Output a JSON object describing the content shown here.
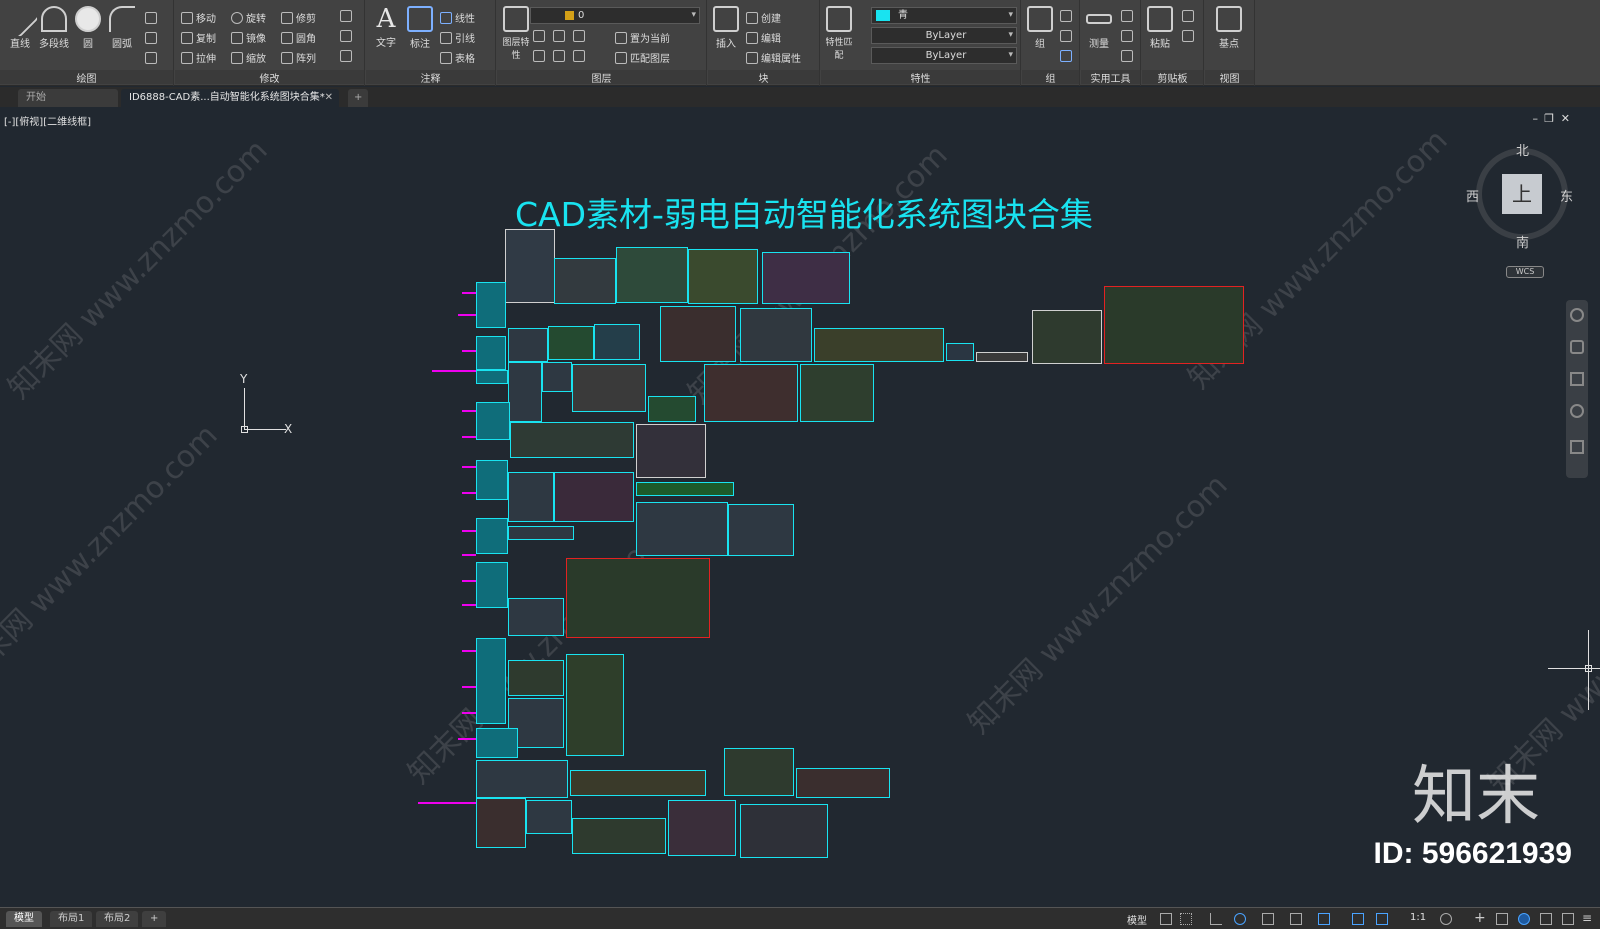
{
  "ribbon": {
    "draw": {
      "line": "直线",
      "polyline": "多段线",
      "circle": "圆",
      "arc": "圆弧",
      "title": "绘图"
    },
    "modify": {
      "move": "移动",
      "rotate": "旋转",
      "trim": "修剪",
      "copy": "复制",
      "mirror": "镜像",
      "fillet": "圆角",
      "stretch": "拉伸",
      "scale": "缩放",
      "array": "阵列",
      "title": "修改"
    },
    "annotation": {
      "text": "文字",
      "dimension": "标注",
      "linear": "线性",
      "leader": "引线",
      "table": "表格",
      "title": "注释"
    },
    "layers": {
      "layer_props": "图层特性",
      "current_layer": "0",
      "make_current": "置为当前",
      "match_layer": "匹配图层",
      "title": "图层"
    },
    "block": {
      "insert": "插入",
      "create": "创建",
      "edit": "编辑",
      "edit_attr": "编辑属性",
      "title": "块"
    },
    "properties": {
      "match": "特性匹配",
      "color": "青",
      "linetype": "ByLayer",
      "lineweight": "ByLayer",
      "title": "特性"
    },
    "groups": {
      "group": "组",
      "title": "组"
    },
    "utilities": {
      "measure": "测量",
      "title": "实用工具"
    },
    "clipboard": {
      "paste": "粘贴",
      "title": "剪贴板"
    },
    "view": {
      "base": "基点",
      "title": "视图"
    }
  },
  "tabs": {
    "start": "开始",
    "document": "ID6888-CAD素...自动智能化系统图块合集*",
    "add": "+"
  },
  "viewport": {
    "label": "[-][俯视][二维线框]",
    "axis_y": "Y",
    "axis_x": "X"
  },
  "drawing": {
    "title": "CAD素材-弱电自动智能化系统图块合集"
  },
  "viewcube": {
    "north": "北",
    "south": "南",
    "east": "东",
    "west": "西",
    "face": "上",
    "wcs": "WCS"
  },
  "layouts": {
    "model": "模型",
    "layout1": "布局1",
    "layout2": "布局2",
    "add": "+"
  },
  "status": {
    "model": "模型",
    "scale": "1:1"
  },
  "watermark": {
    "text": "知末网 www.znzmo.com",
    "brand": "知末",
    "id": "ID: 596621939"
  },
  "colors": {
    "background": "#212830",
    "cyan": "#19e3f0",
    "red": "#e32222",
    "magenta": "#ee00ee",
    "ribbon": "#424242"
  }
}
